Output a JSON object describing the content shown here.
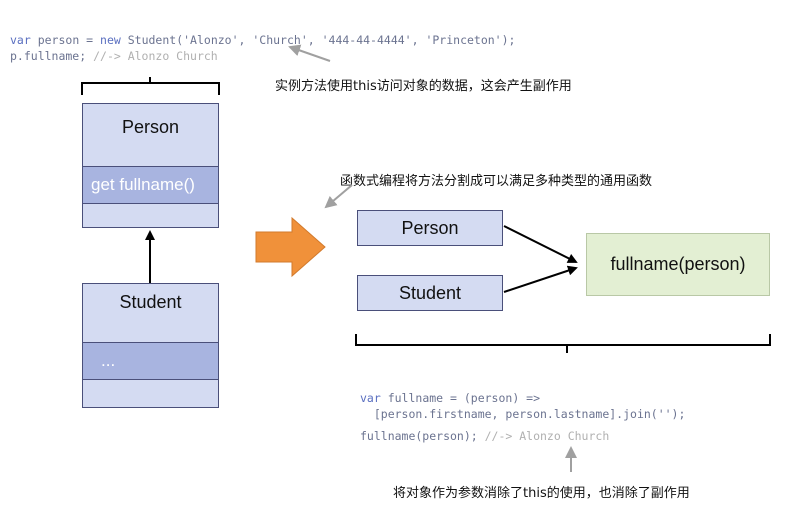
{
  "top_code": {
    "line1_var": "var",
    "line1_a": " person = ",
    "line1_new": "new",
    "line1_b": " Student('Alonzo', 'Church', '444-44-4444', 'Princeton');",
    "line2_a": "p.fullname; ",
    "line2_comment": "//-> Alonzo Church"
  },
  "notes": {
    "instance_method": "实例方法使用this访问对象的数据，这会产生副作用",
    "functional": "函数式编程将方法分割成可以满足多种类型的通用函数",
    "param": "将对象作为参数消除了this的使用，也消除了副作用"
  },
  "left_diagram": {
    "person_title": "Person",
    "person_method": "get fullname()",
    "student_title": "Student",
    "student_method": "..."
  },
  "right_diagram": {
    "person_box": "Person",
    "student_box": "Student",
    "function_box": "fullname(person)"
  },
  "bottom_code": {
    "line1_var": "var",
    "line1_rest": " fullname = (person) =>",
    "line2": "  [person.firstname, person.lastname].join('');",
    "line3_a": "fullname(person); ",
    "line3_comment": "//-> Alonzo Church"
  },
  "colors": {
    "uml_fill": "#d4dbf2",
    "uml_method_fill": "#a8b4e0",
    "function_fill": "#e3efd3",
    "arrow_orange": "#f0913a"
  }
}
